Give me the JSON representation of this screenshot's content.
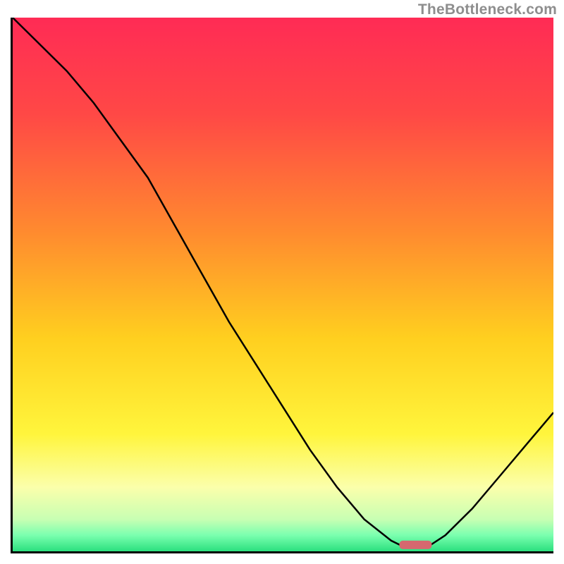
{
  "watermark": "TheBottleneck.com",
  "chart_data": {
    "type": "line",
    "title": "",
    "xlabel": "",
    "ylabel": "",
    "xlim": [
      0,
      100
    ],
    "ylim": [
      0,
      100
    ],
    "grid": false,
    "legend": "none",
    "series": [
      {
        "name": "curve",
        "x": [
          0,
          5,
          10,
          15,
          20,
          25,
          30,
          35,
          40,
          45,
          50,
          55,
          60,
          65,
          70,
          72,
          77,
          80,
          85,
          90,
          95,
          100
        ],
        "y": [
          100,
          95,
          90,
          84,
          77,
          70,
          61,
          52,
          43,
          35,
          27,
          19,
          12,
          6,
          2,
          1,
          1,
          3,
          8,
          14,
          20,
          26
        ]
      }
    ],
    "marker": {
      "x_center": 74.5,
      "width_pct": 6,
      "y": 1.2
    },
    "background_gradient": {
      "stops": [
        {
          "pct": 0,
          "color": "#ff2b55"
        },
        {
          "pct": 18,
          "color": "#ff4846"
        },
        {
          "pct": 40,
          "color": "#ff8a2f"
        },
        {
          "pct": 60,
          "color": "#ffcf1f"
        },
        {
          "pct": 78,
          "color": "#fff53c"
        },
        {
          "pct": 88,
          "color": "#fbffab"
        },
        {
          "pct": 94,
          "color": "#c8ffb3"
        },
        {
          "pct": 97,
          "color": "#7affaf"
        },
        {
          "pct": 100,
          "color": "#2be07e"
        }
      ]
    }
  }
}
